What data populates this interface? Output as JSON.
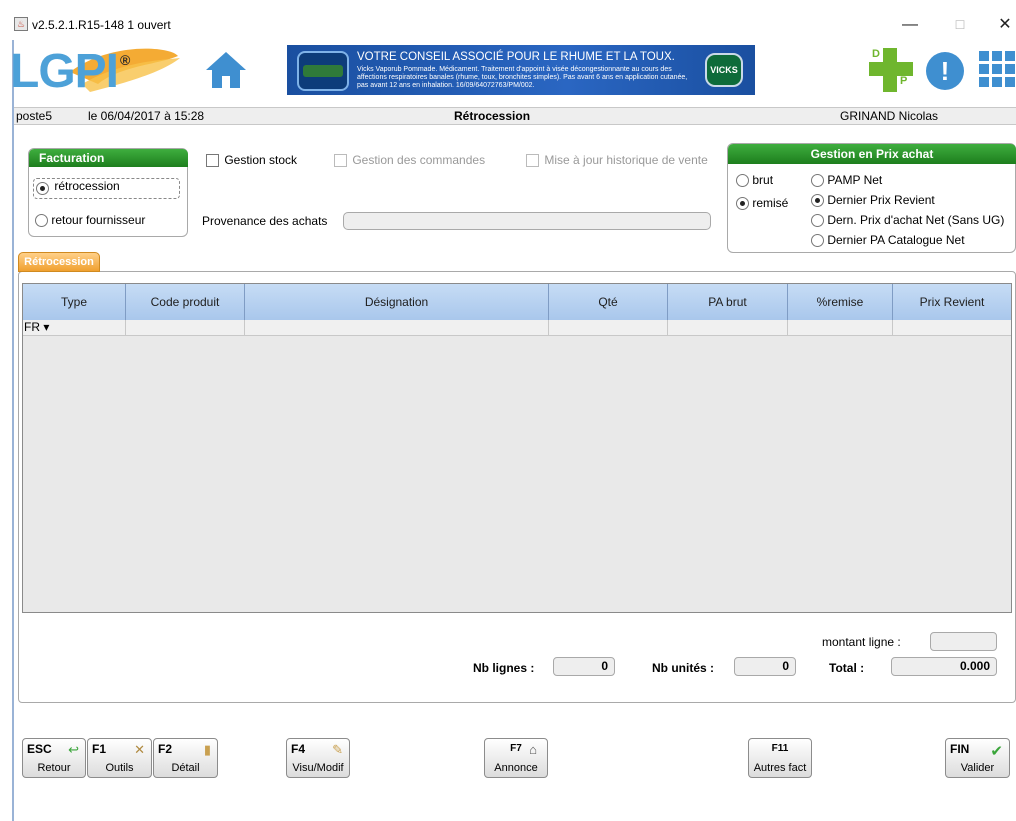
{
  "window": {
    "title": "v2.5.2.1.R15-148 1 ouvert",
    "minimize": "—",
    "maximize": "☐",
    "close": "✕"
  },
  "header": {
    "logo_text": "LGPI",
    "logo_reg": "®",
    "home_icon": "home-icon",
    "banner": {
      "line1": "VOTRE CONSEIL ASSOCIÉ POUR LE RHUME ET LA TOUX.",
      "line2": "Vicks Vaporub Pommade. Médicament. Traitement d'appoint à visée décongestionnante au cours des affections respiratoires banales (rhume, toux, bronchites simples). Pas avant 6 ans en application cutanée, pas avant 12 ans en inhalation. 16/09/64072763/PM/002.",
      "brand": "VICKS"
    },
    "dp_d": "D",
    "dp_p": "P",
    "alert_symbol": "!"
  },
  "info": {
    "poste": "poste5",
    "date": "le 06/04/2017 à 15:28",
    "screen_title": "Rétrocession",
    "user": "GRINAND Nicolas"
  },
  "facturation": {
    "title": "Facturation",
    "options": [
      "rétrocession",
      "retour fournisseur"
    ]
  },
  "options": {
    "gestion_stock": "Gestion stock",
    "gestion_commandes": "Gestion des commandes",
    "mise_a_jour": "Mise à jour historique de vente",
    "provenance_label": "Provenance des achats",
    "provenance_value": ""
  },
  "prix_achat": {
    "title": "Gestion en Prix achat",
    "left": [
      "brut",
      "remisé"
    ],
    "right": [
      "PAMP Net",
      "Dernier Prix Revient",
      "Dern. Prix d'achat Net (Sans UG)",
      "Dernier PA Catalogue Net"
    ]
  },
  "tab": {
    "label": "Rétrocession"
  },
  "grid": {
    "columns": [
      "Type",
      "Code produit",
      "Désignation",
      "Qté",
      "PA brut",
      "%remise",
      "Prix Revient"
    ],
    "row1_type": "FR ▾"
  },
  "totals": {
    "montant_ligne_label": "montant ligne :",
    "montant_ligne_value": "",
    "nb_lignes_label": "Nb lignes :",
    "nb_lignes_value": "0",
    "nb_unites_label": "Nb unités :",
    "nb_unites_value": "0",
    "total_label": "Total :",
    "total_value": "0.000"
  },
  "buttons": [
    {
      "key": "ESC",
      "caption": "Retour",
      "icon": "arrow-back-icon"
    },
    {
      "key": "F1",
      "caption": "Outils",
      "icon": "tools-icon"
    },
    {
      "key": "F2",
      "caption": "Détail",
      "icon": "detail-icon"
    },
    {
      "key": "F4",
      "caption": "Visu/Modif",
      "icon": "edit-icon"
    },
    {
      "key": "F7",
      "caption": "Annonce",
      "icon": "announce-icon"
    },
    {
      "key": "F11",
      "caption": "Autres fact",
      "icon": ""
    },
    {
      "key": "FIN",
      "caption": "Valider",
      "icon": "check-icon"
    }
  ],
  "colors": {
    "accent_green": "#1d7e1d",
    "accent_blue": "#4da1d8",
    "tab_orange": "#f0a030",
    "grid_header": "#a9c7ec"
  }
}
